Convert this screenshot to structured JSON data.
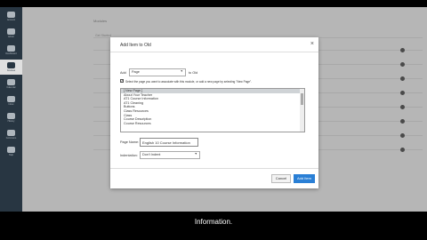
{
  "nav": {
    "items": [
      {
        "label": "Account",
        "active": false
      },
      {
        "label": "Admin",
        "active": false
      },
      {
        "label": "Dashboard",
        "active": false
      },
      {
        "label": "Courses",
        "active": true
      },
      {
        "label": "Calendar",
        "active": false
      },
      {
        "label": "Inbox",
        "active": false
      },
      {
        "label": "History",
        "active": false
      },
      {
        "label": "Commons",
        "active": false
      },
      {
        "label": "Help",
        "active": false
      }
    ]
  },
  "background": {
    "header": "Modules",
    "row_labels": [
      "Get Started",
      "",
      "",
      "",
      "",
      "",
      "",
      ""
    ]
  },
  "modal": {
    "title": "Add Item to Old",
    "close": "×",
    "add_label": "Add",
    "type_value": "Page",
    "to_label": "to Old",
    "checkbox_text": "Select the page you want to associate with this module, or add a new page by selecting \"New Page\".",
    "pages": [
      "[ New Page ]",
      "About Your Teacher",
      "AT1 Course Information",
      "AT1 Cleaning",
      "Buttons",
      "Class Resources",
      "Class",
      "Course Description",
      "Course Resources"
    ],
    "selected_index": 0,
    "page_name_label": "Page Name:",
    "page_name_value": "English 10 Course Information",
    "indentation_label": "Indentation:",
    "indentation_value": "Don't Indent",
    "cancel": "Cancel",
    "add_item": "Add Item"
  },
  "caption": "Information."
}
